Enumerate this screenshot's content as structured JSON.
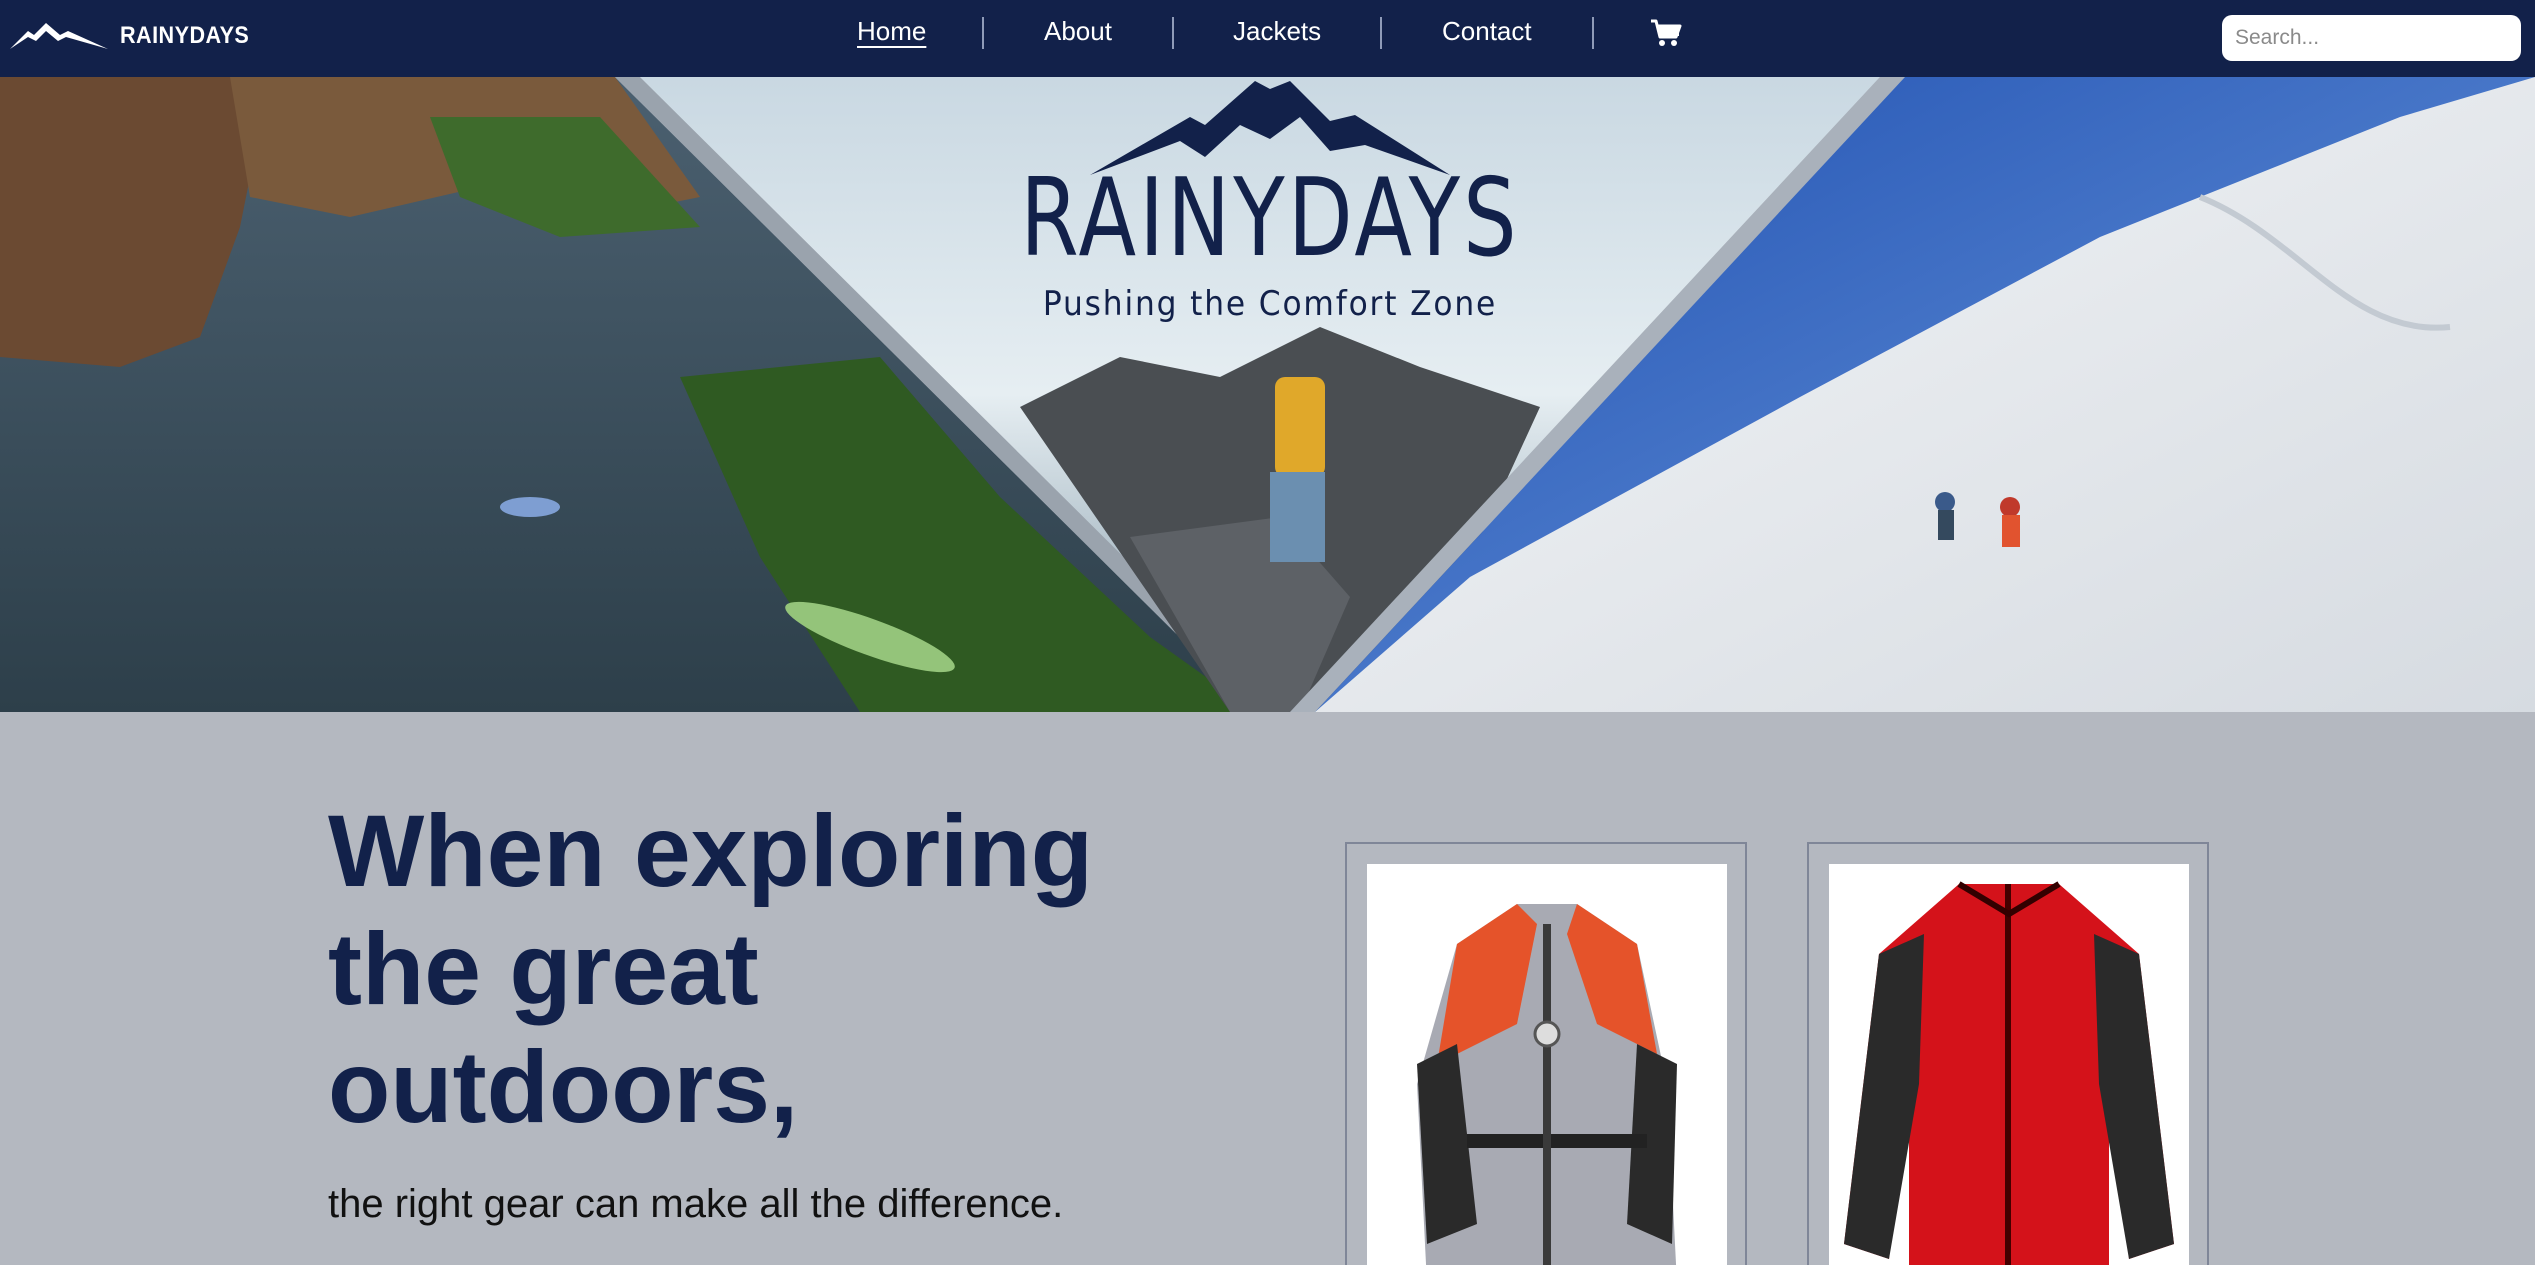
{
  "nav": {
    "brand": "RAINYDAYS",
    "items": [
      {
        "label": "Home",
        "active": true
      },
      {
        "label": "About"
      },
      {
        "label": "Jackets"
      },
      {
        "label": "Contact"
      }
    ],
    "cart_icon": "shopping-cart-icon",
    "search_placeholder": "Search..."
  },
  "hero": {
    "title": "RAINYDAYS",
    "tagline": "Pushing the Comfort Zone",
    "panels": [
      "kayaking-lake-photo",
      "hiker-on-mountain-photo",
      "skiers-on-snow-slope-photo"
    ]
  },
  "intro": {
    "headline_lines": [
      "When exploring",
      "the great",
      "outdoors,"
    ],
    "subline": "the right gear can make all the difference."
  },
  "products": [
    {
      "image": "orange-grey-rain-jacket"
    },
    {
      "image": "red-black-softshell-jacket"
    }
  ],
  "colors": {
    "navy": "#12214a",
    "page_bg": "#b4b8c0",
    "white": "#ffffff"
  }
}
